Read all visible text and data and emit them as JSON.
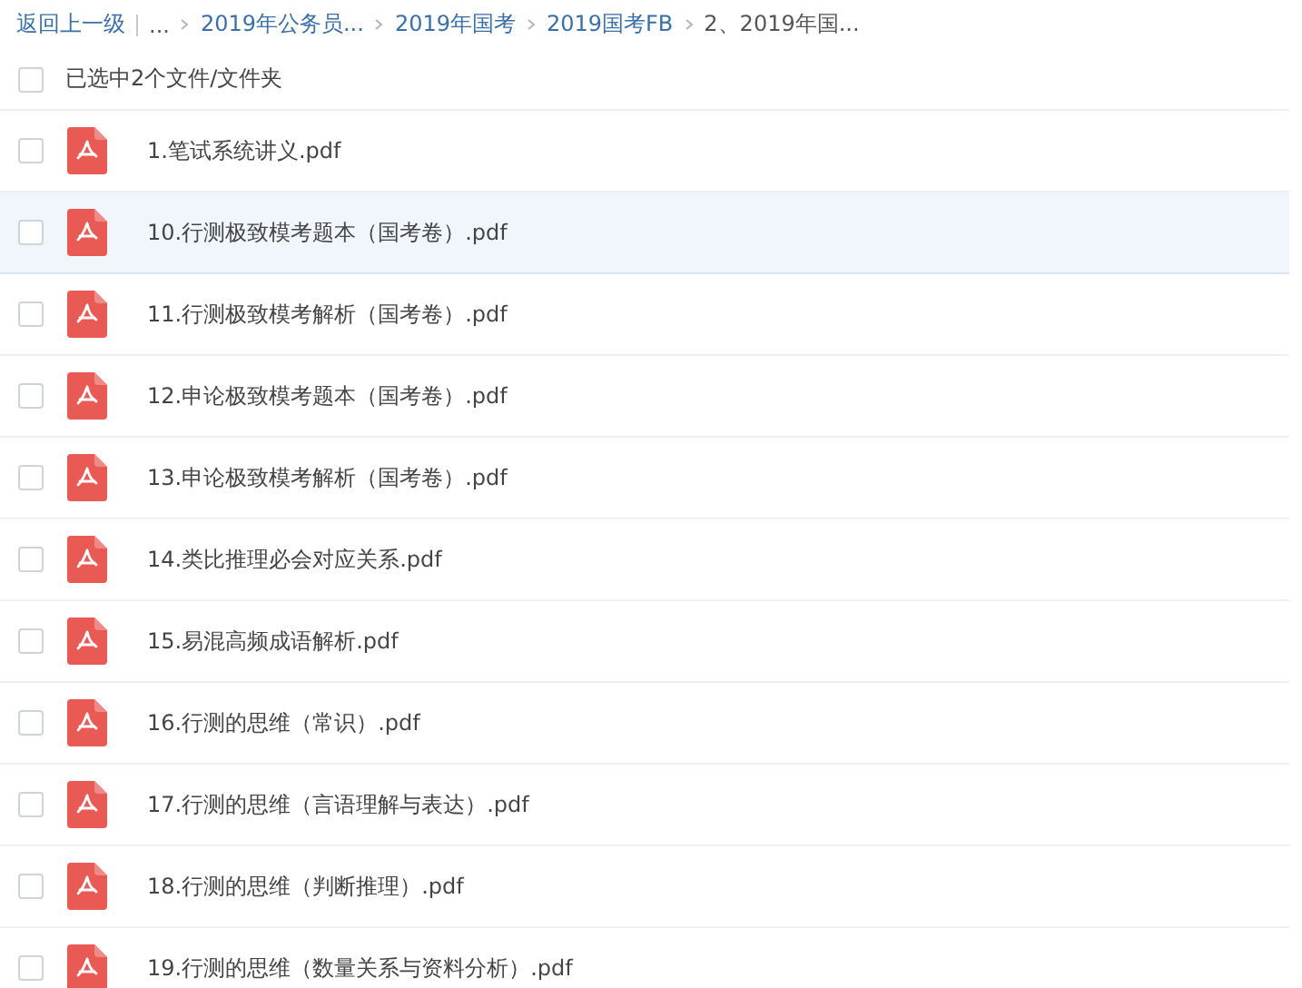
{
  "breadcrumb": {
    "back": "返回上一级",
    "ellipsis": "...",
    "items": [
      {
        "label": "2019年公务员...",
        "current": false
      },
      {
        "label": "2019年国考",
        "current": false
      },
      {
        "label": "2019国考FB",
        "current": false
      },
      {
        "label": "2、2019年国...",
        "current": true
      }
    ]
  },
  "selection": {
    "label": "已选中2个文件/文件夹",
    "checked": false
  },
  "files": [
    {
      "name": "1.笔试系统讲义.pdf",
      "checked": false,
      "highlighted": false
    },
    {
      "name": "10.行测极致模考题本（国考卷）.pdf",
      "checked": false,
      "highlighted": true
    },
    {
      "name": "11.行测极致模考解析（国考卷）.pdf",
      "checked": false,
      "highlighted": false
    },
    {
      "name": "12.申论极致模考题本（国考卷）.pdf",
      "checked": false,
      "highlighted": false
    },
    {
      "name": "13.申论极致模考解析（国考卷）.pdf",
      "checked": false,
      "highlighted": false
    },
    {
      "name": "14.类比推理必会对应关系.pdf",
      "checked": false,
      "highlighted": false
    },
    {
      "name": "15.易混高频成语解析.pdf",
      "checked": false,
      "highlighted": false
    },
    {
      "name": "16.行测的思维（常识）.pdf",
      "checked": false,
      "highlighted": false
    },
    {
      "name": "17.行测的思维（言语理解与表达）.pdf",
      "checked": false,
      "highlighted": false
    },
    {
      "name": "18.行测的思维（判断推理）.pdf",
      "checked": false,
      "highlighted": false
    },
    {
      "name": "19.行测的思维（数量关系与资料分析）.pdf",
      "checked": false,
      "highlighted": false
    }
  ]
}
